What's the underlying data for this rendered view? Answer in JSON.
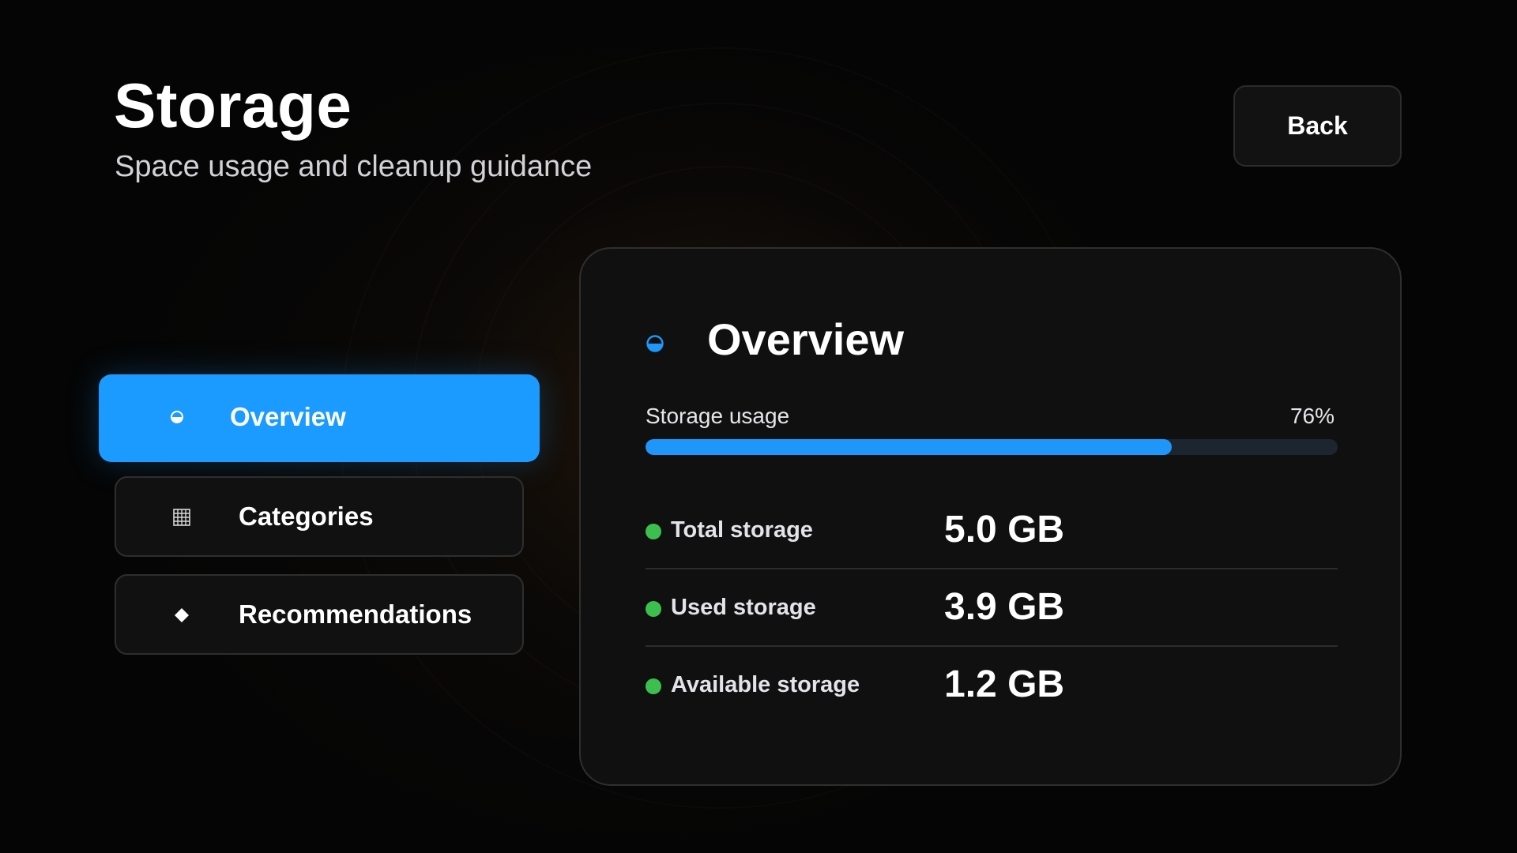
{
  "header": {
    "title": "Storage",
    "subtitle": "Space usage and cleanup guidance",
    "back_label": "Back"
  },
  "nav": {
    "items": [
      {
        "label": "Overview",
        "icon": "half-circle-icon",
        "active": true
      },
      {
        "label": "Categories",
        "icon": "grid-icon",
        "active": false
      },
      {
        "label": "Recommendations",
        "icon": "diamond-icon",
        "active": false
      }
    ]
  },
  "overview": {
    "title": "Overview",
    "icon": "half-circle-icon",
    "usage_label": "Storage usage",
    "usage_percent_text": "76%",
    "usage_fraction": 0.76,
    "stats": [
      {
        "label": "Total storage",
        "value": "5.0 GB"
      },
      {
        "label": "Used storage",
        "value": "3.9 GB"
      },
      {
        "label": "Available storage",
        "value": "1.2 GB"
      }
    ]
  },
  "colors": {
    "accent": "#1b9bff",
    "progress_fill": "#1e96fa",
    "progress_track": "#1c2530",
    "status_dot": "#3cbf4f",
    "panel_background": "#101010",
    "page_background": "#050505"
  }
}
